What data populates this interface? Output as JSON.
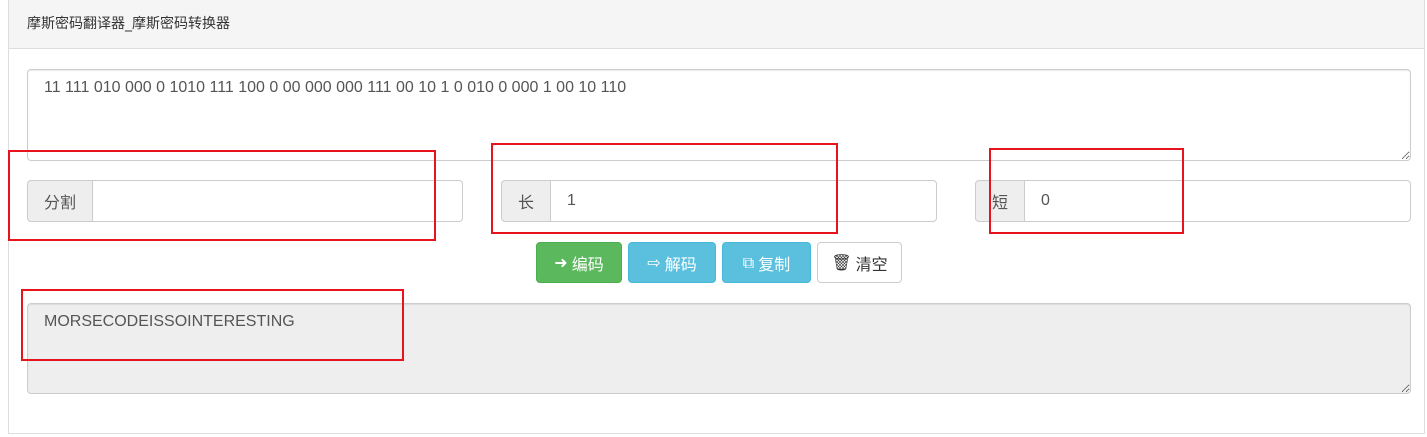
{
  "title": "摩斯密码翻译器_摩斯密码转换器",
  "input": "11 111 010 000 0 1010 111 100 0 00 000 000 111 00 10 1 0 010 0 000 1 00 10 110",
  "split": {
    "label": "分割",
    "value": ""
  },
  "long": {
    "label": "长",
    "value": "1"
  },
  "short": {
    "label": "短",
    "value": "0"
  },
  "buttons": {
    "encode": "编码",
    "decode": "解码",
    "copy": "复制",
    "clear": "清空"
  },
  "output": "MORSECODEISSOINTERESTING",
  "colors": {
    "annotation": "#e8141d",
    "encode": "#5cb85c",
    "decode": "#5bc0de"
  }
}
